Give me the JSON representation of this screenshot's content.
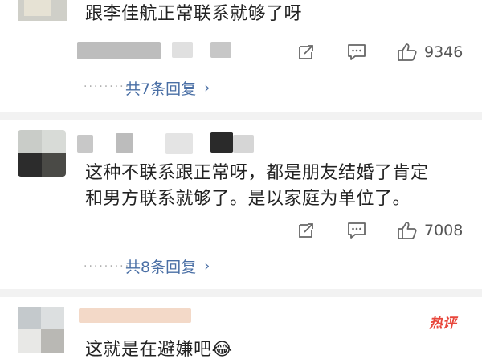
{
  "comments": [
    {
      "text": "跟李佳航正常联系就够了呀",
      "like_count": "9346",
      "replies_label": "共7条回复"
    },
    {
      "text_line1": "这种不联系跟正常呀，都是朋友结婚了肯定",
      "text_line2": "和男方联系就够了。是以家庭为单位了。",
      "like_count": "7008",
      "replies_label": "共8条回复"
    },
    {
      "text": "这就是在避嫌吧😂"
    }
  ],
  "dots": "·········",
  "chevron": "›",
  "watermark": "热评",
  "icons": [
    "share-icon",
    "comment-icon",
    "like-icon",
    "chevron-right-icon"
  ],
  "colors": {
    "link": "#4a6fa5",
    "meta": "#555555",
    "accent": "#e8473c",
    "separator": "#f2f2f2"
  }
}
